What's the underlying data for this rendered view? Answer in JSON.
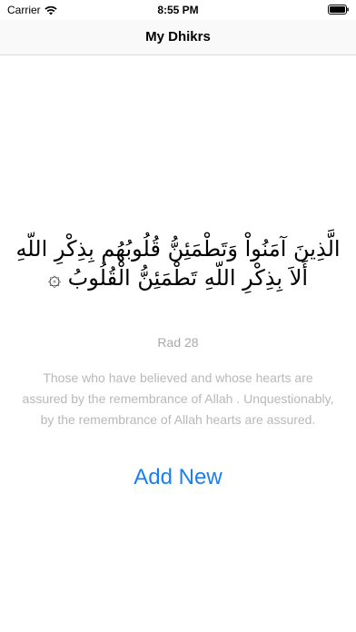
{
  "status_bar": {
    "carrier": "Carrier",
    "time": "8:55 PM"
  },
  "nav": {
    "title": "My Dhikrs"
  },
  "dhikr": {
    "arabic": "الَّذِينَ آمَنُواْ وَتَطْمَئِنُّ قُلُوبُهُم بِذِكْرِ اللّهِ أَلاَ بِذِكْرِ اللّهِ تَطْمَئِنُّ الْقُلُوبُ ۞",
    "reference": "Rad 28",
    "translation": "Those who have believed and whose hearts are assured by the remembrance of Allah . Unquestionably, by the remembrance of Allah hearts are assured."
  },
  "actions": {
    "add_new_label": "Add New"
  },
  "colors": {
    "accent": "#1a7ff0",
    "muted_text": "#b8b8b8"
  },
  "icons": [
    "wifi-icon",
    "battery-icon"
  ]
}
